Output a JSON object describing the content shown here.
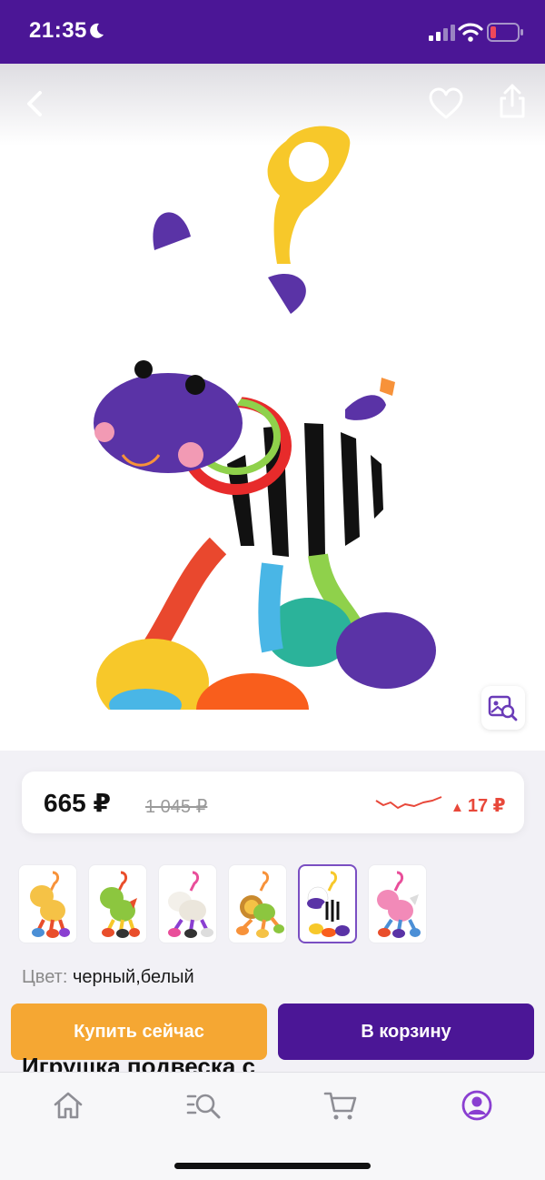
{
  "status_bar": {
    "time": "21:35",
    "icons": [
      "moon-icon",
      "signal-icon",
      "wifi-icon",
      "battery-icon"
    ]
  },
  "top_nav": {
    "icons": [
      "back-icon",
      "heart-icon",
      "share-icon"
    ]
  },
  "hero": {
    "visual_search_icon": "image-search-icon"
  },
  "price": {
    "current": "665 ₽",
    "old": "1 045 ₽",
    "change_arrow": "▲",
    "change": "17 ₽",
    "change_color": "#e8483a"
  },
  "thumbnails": [
    {
      "name": "giraffe",
      "selected": false
    },
    {
      "name": "dragon",
      "selected": false
    },
    {
      "name": "sheep",
      "selected": false
    },
    {
      "name": "lion",
      "selected": false
    },
    {
      "name": "zebra",
      "selected": true
    },
    {
      "name": "pony",
      "selected": false
    }
  ],
  "color": {
    "label": "Цвет:",
    "value": "черный,белый"
  },
  "actions": {
    "buy_now": "Купить сейчас",
    "add_to_cart": "В корзину"
  },
  "product_title": "Игрушка подвеска с",
  "tab_bar": {
    "icons": [
      "home-icon",
      "catalog-search-icon",
      "cart-icon",
      "profile-icon"
    ],
    "active": "profile-icon"
  },
  "colors": {
    "brand_purple": "#4b1696",
    "buy_orange": "#f5a733",
    "active_tab": "#8a3fd1"
  }
}
